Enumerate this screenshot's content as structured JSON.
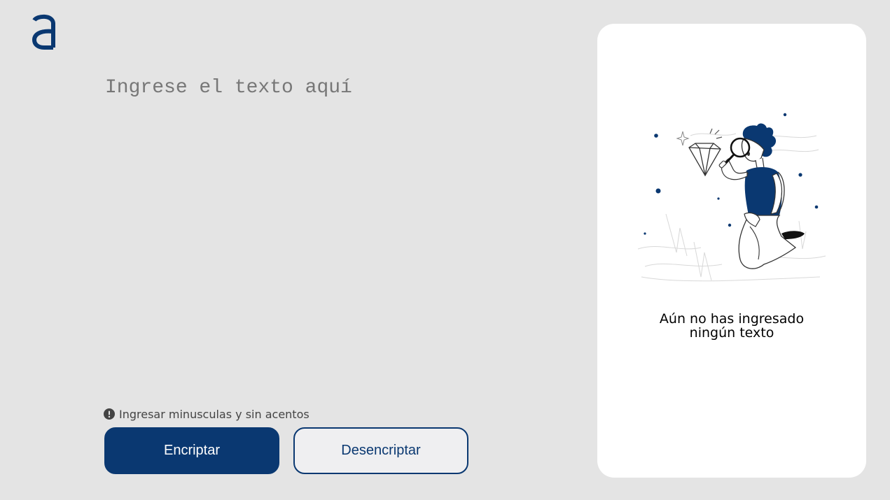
{
  "brand": {
    "logo_icon": "alura-a-logo",
    "accent_color": "#0a3871"
  },
  "editor": {
    "placeholder": "Ingrese el texto aquí",
    "value": ""
  },
  "hint": {
    "icon": "exclamation-circle-icon",
    "text": "Ingresar minusculas y sin acentos"
  },
  "actions": {
    "encrypt_label": "Encriptar",
    "decrypt_label": "Desencriptar"
  },
  "output_panel": {
    "illustration": "person-with-magnifying-glass-illustration",
    "message_line1": "Aún no has ingresado",
    "message_line2": "ningún texto"
  }
}
